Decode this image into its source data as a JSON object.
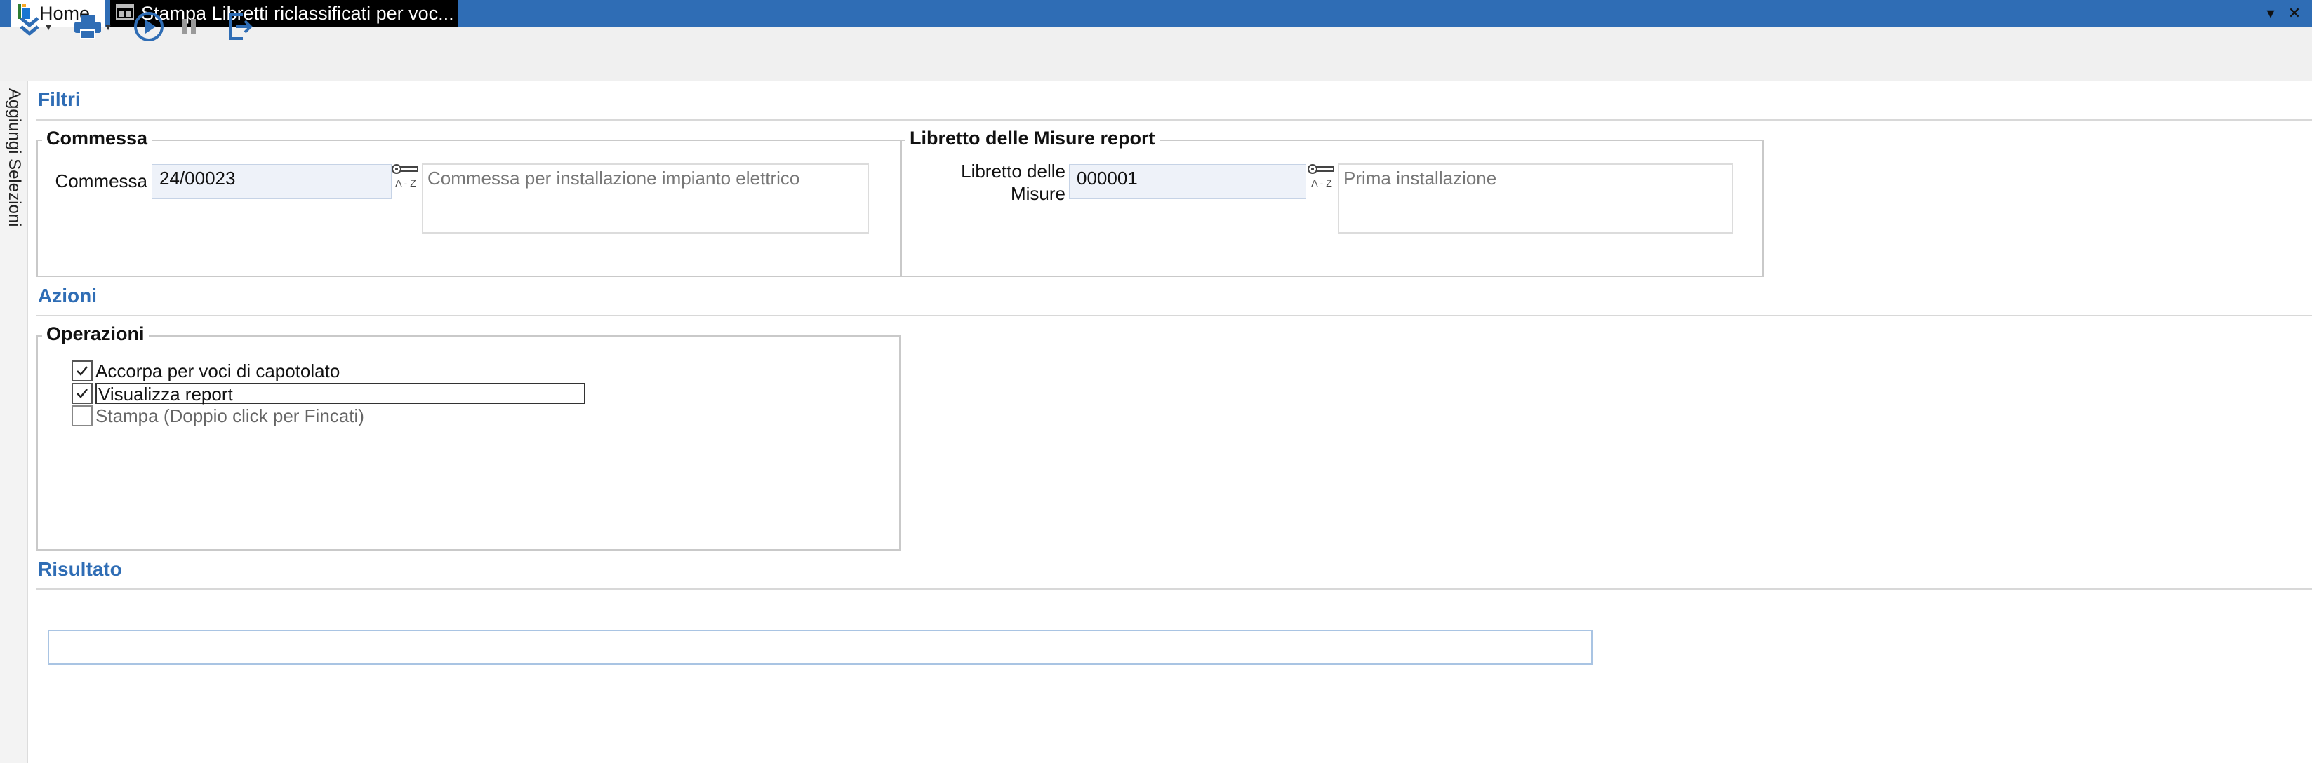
{
  "tabs": {
    "home": "Home",
    "active": "Stampa Libretti riclassificati per voc..."
  },
  "window_controls": {
    "minimize": "▾",
    "close": "✕"
  },
  "toolbar": {
    "icons": [
      "expand-icon",
      "print-icon",
      "play-icon",
      "pause-icon",
      "exit-icon"
    ]
  },
  "side_panel": {
    "label": "Aggiungi Selezioni"
  },
  "sections": {
    "filtri": "Filtri",
    "azioni": "Azioni",
    "risultato": "Risultato"
  },
  "commessa": {
    "group_title": "Commessa",
    "label": "Commessa",
    "value": "24/00023",
    "description": "Commessa per installazione impianto elettrico"
  },
  "libretto": {
    "group_title": "Libretto delle Misure report",
    "label_line1": "Libretto delle",
    "label_line2": "Misure",
    "value": "000001",
    "description": "Prima installazione"
  },
  "lookup_icon": {
    "text": "A - Z"
  },
  "operazioni": {
    "group_title": "Operazioni",
    "options": [
      {
        "label": "Accorpa per voci di capotolato",
        "checked": true,
        "enabled": true
      },
      {
        "label": "Visualizza report",
        "checked": true,
        "enabled": true
      },
      {
        "label": "Stampa (Doppio click per Fincati)",
        "checked": false,
        "enabled": false
      }
    ]
  },
  "risultato": {
    "value": ""
  },
  "colors": {
    "accent": "#2f6db5",
    "titlebar": "#2f6db5",
    "field_bg": "#eef2f9"
  }
}
